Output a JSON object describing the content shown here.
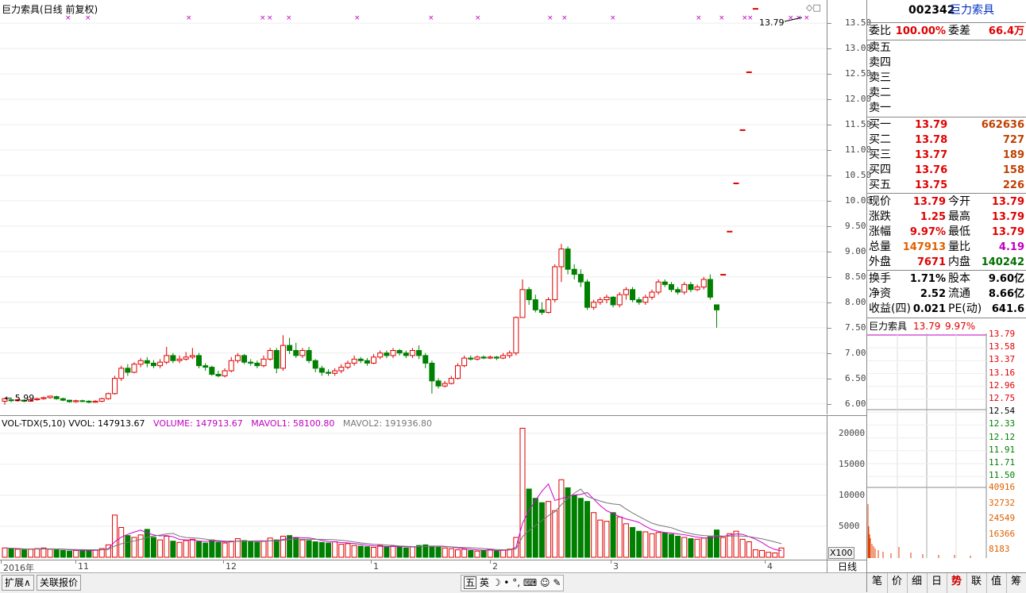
{
  "chart_title": "巨力索具(日线 前复权)",
  "last_price_label": "13.79",
  "low_marker_label": "5.99",
  "price_ticks": [
    "13.50",
    "13.00",
    "12.50",
    "12.00",
    "11.50",
    "11.00",
    "10.50",
    "10.00",
    "9.50",
    "9.00",
    "8.50",
    "8.00",
    "7.50",
    "7.00",
    "6.50",
    "6.00"
  ],
  "volume_indicator": {
    "name": "VOL-TDX(5,10)",
    "vvol": "VVOL: 147913.67",
    "volume": "VOLUME: 147913.67",
    "mavol1": "MAVOL1: 58100.80",
    "mavol2": "MAVOL2: 191936.80"
  },
  "volume_ticks": [
    "20000",
    "15000",
    "10000",
    "5000"
  ],
  "volume_scale_label": "X100",
  "date_labels": [
    "2016年",
    "11",
    "12",
    "1",
    "2",
    "3",
    "4"
  ],
  "period_label": "日线",
  "bottom_tabs": [
    "扩展∧",
    "关联报价"
  ],
  "ime_toolbar": [
    "五",
    "英"
  ],
  "quote": {
    "code": "002342",
    "name": "巨力索具",
    "weibi_label": "委比",
    "weibi": "100.00%",
    "weicha_label": "委差",
    "weicha": "66.4万",
    "sell": [
      {
        "label": "卖五",
        "price": "",
        "vol": ""
      },
      {
        "label": "卖四",
        "price": "",
        "vol": ""
      },
      {
        "label": "卖三",
        "price": "",
        "vol": ""
      },
      {
        "label": "卖二",
        "price": "",
        "vol": ""
      },
      {
        "label": "卖一",
        "price": "",
        "vol": ""
      }
    ],
    "buy": [
      {
        "label": "买一",
        "price": "13.79",
        "vol": "662636"
      },
      {
        "label": "买二",
        "price": "13.78",
        "vol": "727"
      },
      {
        "label": "买三",
        "price": "13.77",
        "vol": "189"
      },
      {
        "label": "买四",
        "price": "13.76",
        "vol": "158"
      },
      {
        "label": "买五",
        "price": "13.75",
        "vol": "226"
      }
    ],
    "stats": [
      {
        "l1": "现价",
        "v1": "13.79",
        "l2": "今开",
        "v2": "13.79"
      },
      {
        "l1": "涨跌",
        "v1": "1.25",
        "l2": "最高",
        "v2": "13.79"
      },
      {
        "l1": "涨幅",
        "v1": "9.97%",
        "l2": "最低",
        "v2": "13.79"
      },
      {
        "l1": "总量",
        "v1": "147913",
        "l2": "量比",
        "v2": "4.19"
      },
      {
        "l1": "外盘",
        "v1": "7671",
        "l2": "内盘",
        "v2": "140242"
      }
    ],
    "fin": [
      {
        "l1": "换手",
        "v1": "1.71%",
        "l2": "股本",
        "v2": "9.60亿"
      },
      {
        "l1": "净资",
        "v1": "2.52",
        "l2": "流通",
        "v2": "8.66亿"
      },
      {
        "l1": "收益(四)",
        "v1": "0.021",
        "l2": "PE(动)",
        "v2": "641.6"
      }
    ]
  },
  "mini": {
    "title": "巨力索具",
    "price": "13.79",
    "pct": "9.97%",
    "price_ticks": [
      "13.79",
      "13.58",
      "13.37",
      "13.16",
      "12.96",
      "12.75",
      "12.54",
      "12.33",
      "12.12",
      "11.91",
      "11.71",
      "11.50"
    ],
    "vol_ticks": [
      "40916",
      "32732",
      "24549",
      "16366",
      "8183"
    ]
  },
  "nav_tabs": [
    "笔",
    "价",
    "细",
    "日",
    "势",
    "联",
    "值",
    "筹"
  ],
  "chart_data": {
    "type": "candlestick",
    "ylim": [
      5.9,
      13.8
    ],
    "candles": [
      [
        6.05,
        6.1,
        5.98,
        6.12
      ],
      [
        6.08,
        6.06,
        6.03,
        6.1
      ],
      [
        6.06,
        6.08,
        6.04,
        6.1
      ],
      [
        6.07,
        6.05,
        6.03,
        6.09
      ],
      [
        6.05,
        6.08,
        6.04,
        6.1
      ],
      [
        6.08,
        6.1,
        6.06,
        6.12
      ],
      [
        6.1,
        6.12,
        6.08,
        6.14
      ],
      [
        6.12,
        6.15,
        6.1,
        6.16
      ],
      [
        6.14,
        6.1,
        6.08,
        6.16
      ],
      [
        6.1,
        6.07,
        6.05,
        6.12
      ],
      [
        6.07,
        6.04,
        6.02,
        6.08
      ],
      [
        6.04,
        6.06,
        6.02,
        6.08
      ],
      [
        6.06,
        6.05,
        6.03,
        6.08
      ],
      [
        6.05,
        6.03,
        6.01,
        6.07
      ],
      [
        6.03,
        6.05,
        6.02,
        6.07
      ],
      [
        6.05,
        6.1,
        6.03,
        6.12
      ],
      [
        6.1,
        6.2,
        6.08,
        6.22
      ],
      [
        6.2,
        6.5,
        6.18,
        6.55
      ],
      [
        6.5,
        6.7,
        6.45,
        6.75
      ],
      [
        6.7,
        6.62,
        6.55,
        6.78
      ],
      [
        6.62,
        6.78,
        6.6,
        6.82
      ],
      [
        6.78,
        6.85,
        6.72,
        6.9
      ],
      [
        6.85,
        6.8,
        6.72,
        6.92
      ],
      [
        6.8,
        6.75,
        6.7,
        6.86
      ],
      [
        6.75,
        6.82,
        6.7,
        6.88
      ],
      [
        6.82,
        6.95,
        6.78,
        7.12
      ],
      [
        6.95,
        6.85,
        6.8,
        7.0
      ],
      [
        6.85,
        6.88,
        6.8,
        6.95
      ],
      [
        6.88,
        6.92,
        6.85,
        7.02
      ],
      [
        6.92,
        6.95,
        6.88,
        7.1
      ],
      [
        6.95,
        6.75,
        6.7,
        7.0
      ],
      [
        6.75,
        6.72,
        6.65,
        6.8
      ],
      [
        6.72,
        6.58,
        6.55,
        6.75
      ],
      [
        6.58,
        6.55,
        6.52,
        6.65
      ],
      [
        6.55,
        6.65,
        6.52,
        6.7
      ],
      [
        6.65,
        6.85,
        6.62,
        6.92
      ],
      [
        6.85,
        6.95,
        6.8,
        7.0
      ],
      [
        6.95,
        6.82,
        6.78,
        6.98
      ],
      [
        6.82,
        6.8,
        6.75,
        6.88
      ],
      [
        6.8,
        6.75,
        6.7,
        6.85
      ],
      [
        6.75,
        6.88,
        6.72,
        6.95
      ],
      [
        6.88,
        7.05,
        6.85,
        7.1
      ],
      [
        7.05,
        6.7,
        6.6,
        7.1
      ],
      [
        6.7,
        7.15,
        6.65,
        7.35
      ],
      [
        7.15,
        7.05,
        6.98,
        7.3
      ],
      [
        7.05,
        6.95,
        6.9,
        7.2
      ],
      [
        6.95,
        7.05,
        6.9,
        7.1
      ],
      [
        7.05,
        6.85,
        6.8,
        7.12
      ],
      [
        6.85,
        6.7,
        6.62,
        6.88
      ],
      [
        6.7,
        6.62,
        6.55,
        6.75
      ],
      [
        6.62,
        6.6,
        6.55,
        6.68
      ],
      [
        6.6,
        6.65,
        6.55,
        6.7
      ],
      [
        6.65,
        6.72,
        6.6,
        6.78
      ],
      [
        6.72,
        6.8,
        6.68,
        6.85
      ],
      [
        6.8,
        6.88,
        6.75,
        6.95
      ],
      [
        6.88,
        6.85,
        6.8,
        6.92
      ],
      [
        6.85,
        6.8,
        6.75,
        6.9
      ],
      [
        6.8,
        6.92,
        6.78,
        6.98
      ],
      [
        6.92,
        7.0,
        6.88,
        7.05
      ],
      [
        7.0,
        6.95,
        6.9,
        7.05
      ],
      [
        6.95,
        7.05,
        6.9,
        7.1
      ],
      [
        7.05,
        7.0,
        6.95,
        7.08
      ],
      [
        7.0,
        6.95,
        6.9,
        7.05
      ],
      [
        6.95,
        7.05,
        6.9,
        7.1
      ],
      [
        7.05,
        6.95,
        6.88,
        7.15
      ],
      [
        6.95,
        6.8,
        6.7,
        7.0
      ],
      [
        6.8,
        6.45,
        6.2,
        6.85
      ],
      [
        6.45,
        6.35,
        6.3,
        6.5
      ],
      [
        6.35,
        6.4,
        6.32,
        6.45
      ],
      [
        6.4,
        6.5,
        6.38,
        6.55
      ],
      [
        6.5,
        6.75,
        6.48,
        6.8
      ],
      [
        6.75,
        6.9,
        6.72,
        6.95
      ],
      [
        6.9,
        6.88,
        6.85,
        6.95
      ],
      [
        6.88,
        6.92,
        6.85,
        6.95
      ],
      [
        6.92,
        6.9,
        6.88,
        6.95
      ],
      [
        6.9,
        6.92,
        6.88,
        6.95
      ],
      [
        6.92,
        6.9,
        6.86,
        6.94
      ],
      [
        6.9,
        6.95,
        6.88,
        7.0
      ],
      [
        6.95,
        7.0,
        6.9,
        7.05
      ],
      [
        7.0,
        7.7,
        6.95,
        7.72
      ],
      [
        7.7,
        8.25,
        7.9,
        8.45
      ],
      [
        8.25,
        8.05,
        7.95,
        8.3
      ],
      [
        8.05,
        7.85,
        7.8,
        8.15
      ],
      [
        7.85,
        7.8,
        7.75,
        8.0
      ],
      [
        7.8,
        8.05,
        7.78,
        8.1
      ],
      [
        8.05,
        8.7,
        8.0,
        8.75
      ],
      [
        8.7,
        9.05,
        8.4,
        9.15
      ],
      [
        9.05,
        8.65,
        8.55,
        9.1
      ],
      [
        8.65,
        8.55,
        8.45,
        8.75
      ],
      [
        8.55,
        8.4,
        8.3,
        8.65
      ],
      [
        8.4,
        7.9,
        7.85,
        8.45
      ],
      [
        7.9,
        8.0,
        7.85,
        8.05
      ],
      [
        8.0,
        8.05,
        7.95,
        8.1
      ],
      [
        8.05,
        8.1,
        7.98,
        8.15
      ],
      [
        8.1,
        7.95,
        7.9,
        8.12
      ],
      [
        7.95,
        8.15,
        7.9,
        8.2
      ],
      [
        8.15,
        8.25,
        8.05,
        8.3
      ],
      [
        8.25,
        8.05,
        8.0,
        8.3
      ],
      [
        8.05,
        8.0,
        7.95,
        8.1
      ],
      [
        8.0,
        8.1,
        7.95,
        8.15
      ],
      [
        8.1,
        8.2,
        8.05,
        8.25
      ],
      [
        8.2,
        8.4,
        8.15,
        8.45
      ],
      [
        8.4,
        8.35,
        8.3,
        8.45
      ],
      [
        8.35,
        8.25,
        8.2,
        8.4
      ],
      [
        8.25,
        8.2,
        8.15,
        8.3
      ],
      [
        8.2,
        8.35,
        8.15,
        8.4
      ],
      [
        8.35,
        8.25,
        8.2,
        8.4
      ],
      [
        8.25,
        8.3,
        8.22,
        8.35
      ],
      [
        8.3,
        8.45,
        8.25,
        8.5
      ],
      [
        8.45,
        8.1,
        8.05,
        8.55
      ],
      [
        7.95,
        7.85,
        7.5,
        7.9
      ],
      [
        8.55,
        8.55,
        8.55,
        8.55
      ],
      [
        9.4,
        9.4,
        9.4,
        9.4
      ],
      [
        10.35,
        10.35,
        10.35,
        10.35
      ],
      [
        11.4,
        11.4,
        11.4,
        11.4
      ],
      [
        12.54,
        12.54,
        12.54,
        12.54
      ],
      [
        13.79,
        13.79,
        13.79,
        13.79
      ]
    ],
    "volumes": [
      1500,
      1400,
      1300,
      1200,
      1300,
      1400,
      1500,
      1300,
      1200,
      1100,
      1000,
      1100,
      1200,
      1100,
      1200,
      1400,
      2000,
      6800,
      4800,
      3500,
      3200,
      3600,
      4500,
      3200,
      2800,
      3400,
      2600,
      2400,
      2700,
      2900,
      2500,
      2300,
      2800,
      2400,
      2300,
      2600,
      3000,
      2700,
      2500,
      2400,
      2600,
      3100,
      2800,
      3400,
      3500,
      3200,
      2800,
      2700,
      2500,
      2400,
      2300,
      2500,
      2100,
      2200,
      1900,
      1800,
      1700,
      1600,
      1900,
      1700,
      1800,
      1600,
      1500,
      1700,
      1900,
      2000,
      1800,
      1600,
      1500,
      1400,
      1200,
      1300,
      1100,
      1000,
      1100,
      1300,
      1000,
      1200,
      1300,
      3200,
      20800,
      11000,
      9500,
      8800,
      9000,
      7500,
      12500,
      11200,
      10000,
      9500,
      9000,
      7200,
      6000,
      5800,
      7200,
      6500,
      5400,
      4800,
      4200,
      4100,
      3800,
      4000,
      3900,
      3700,
      3400,
      3200,
      3000,
      2900,
      3100,
      3300,
      4400,
      3200,
      3800,
      4200,
      2900,
      2500,
      1200,
      1100,
      800,
      700,
      1500
    ]
  }
}
